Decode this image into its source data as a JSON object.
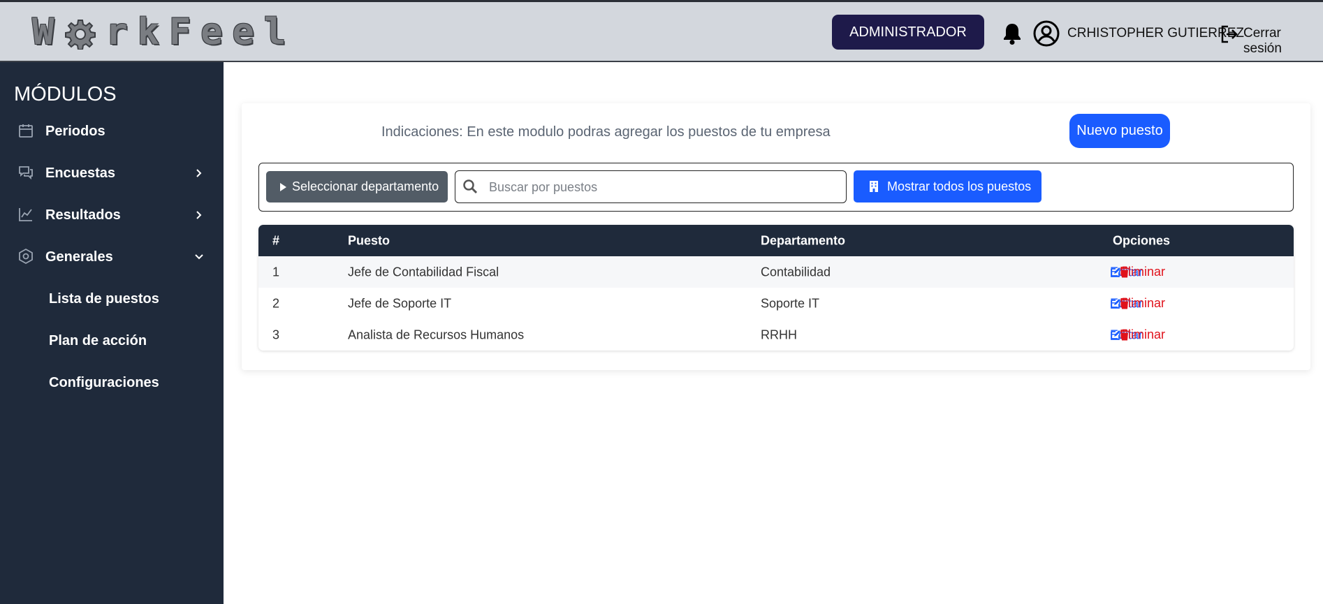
{
  "header": {
    "logo_text": "WorkFeel",
    "role_button": "ADMINISTRADOR",
    "user_name": "CRHISTOPHER GUTIERREZ",
    "logout_label": "Cerrar sesión"
  },
  "sidebar": {
    "title": "MÓDULOS",
    "items": [
      {
        "label": "Periodos",
        "icon": "calendar-icon"
      },
      {
        "label": "Encuestas",
        "icon": "chat-icon"
      },
      {
        "label": "Resultados",
        "icon": "chart-icon"
      },
      {
        "label": "Generales",
        "icon": "settings-hex-icon"
      }
    ],
    "sub_items": [
      {
        "label": "Lista de puestos"
      },
      {
        "label": "Plan de acción"
      },
      {
        "label": "Configuraciones"
      }
    ]
  },
  "main": {
    "indications": "Indicaciones: En este modulo podras agregar los puestos de tu empresa",
    "new_button": "Nuevo puesto",
    "filter": {
      "department_button": "Seleccionar departamento",
      "search_placeholder": "Buscar por puestos",
      "show_all_button": "Mostrar todos los puestos"
    },
    "table": {
      "headers": [
        "#",
        "Puesto",
        "Departamento",
        "Opciones"
      ],
      "rows": [
        {
          "num": "1",
          "puesto": "Jefe de Contabilidad Fiscal",
          "departamento": "Contabilidad"
        },
        {
          "num": "2",
          "puesto": "Jefe de Soporte IT",
          "departamento": "Soporte IT"
        },
        {
          "num": "3",
          "puesto": "Analista de Recursos Humanos",
          "departamento": "RRHH"
        }
      ],
      "edit_label": "Editar",
      "delete_label": "Eliminar"
    }
  },
  "colors": {
    "sidebar_bg": "#1f2a3b",
    "header_bg": "#d3d7dd",
    "primary": "#1a5cff",
    "role_bg": "#1e1a4a",
    "danger": "#e0121b"
  }
}
